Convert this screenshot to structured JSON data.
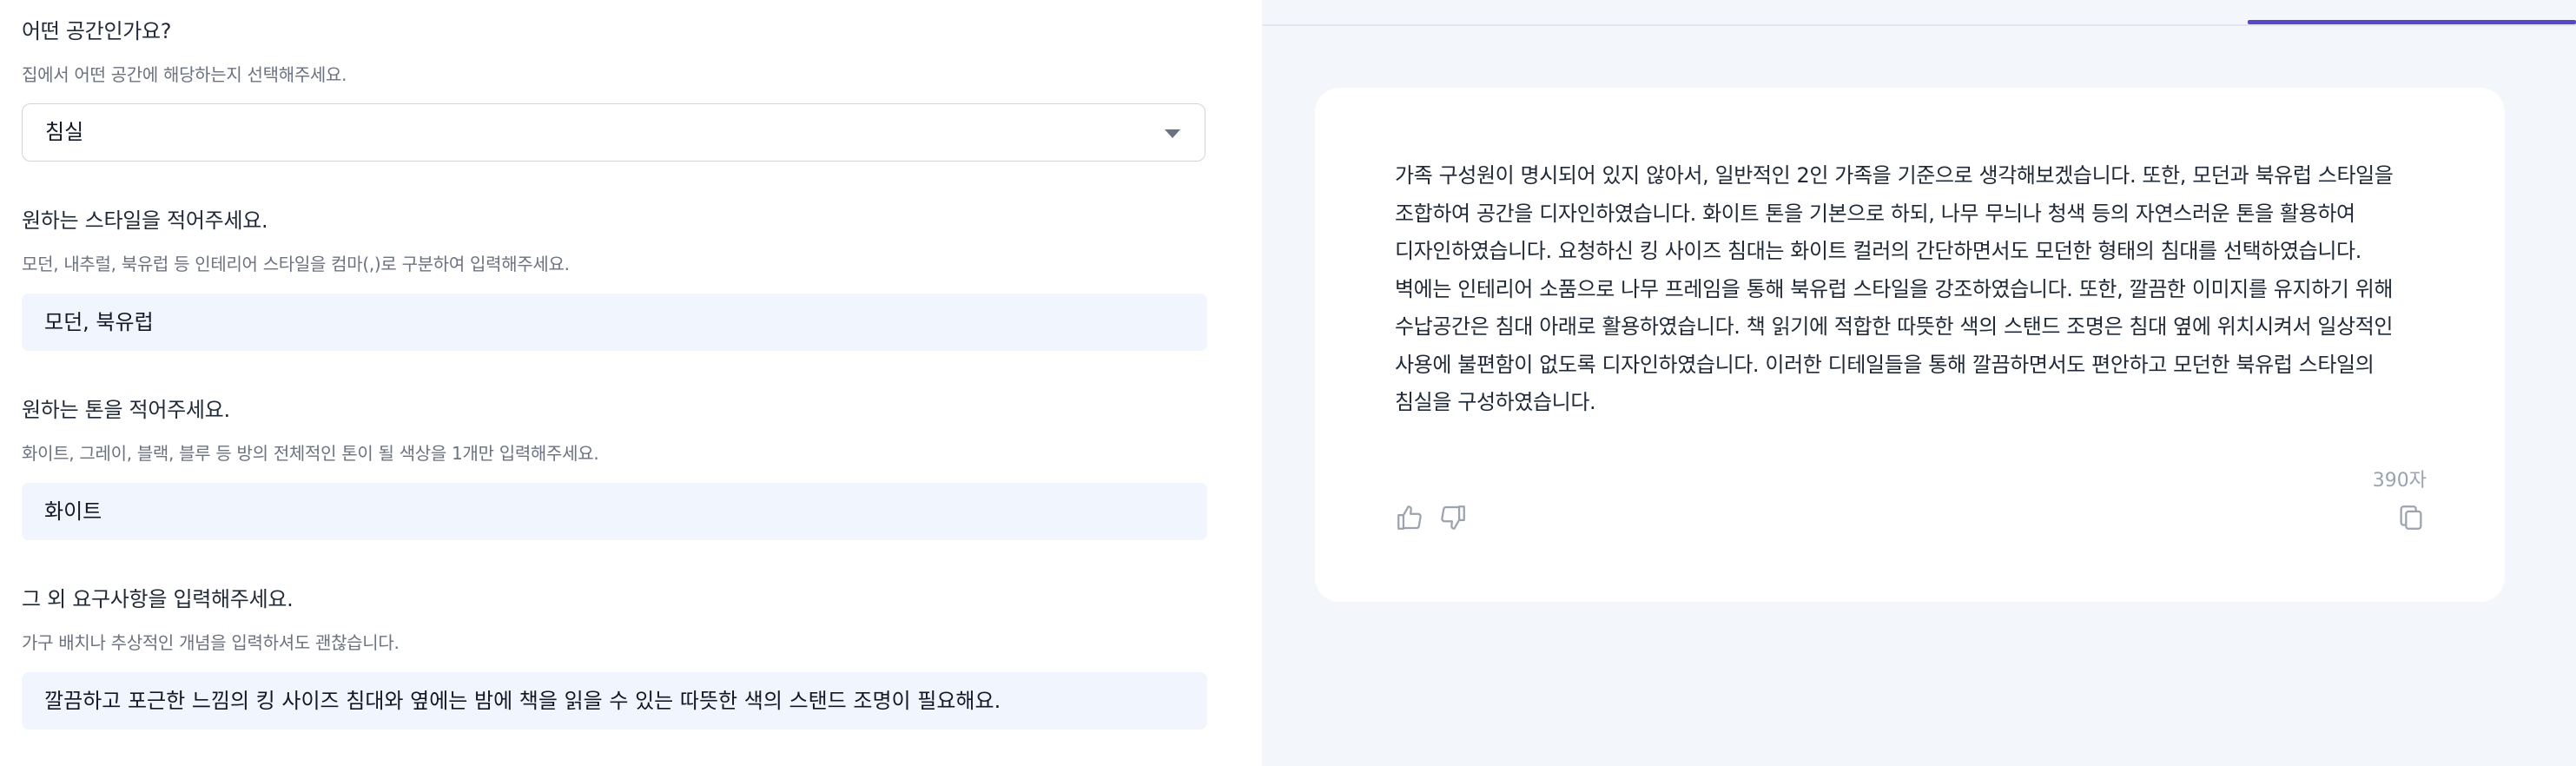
{
  "form": {
    "space": {
      "title": "어떤 공간인가요?",
      "desc": "집에서 어떤 공간에 해당하는지 선택해주세요.",
      "value": "침실"
    },
    "style": {
      "title": "원하는 스타일을 적어주세요.",
      "desc": "모던, 내추럴, 북유럽 등 인테리어 스타일을 컴마(,)로 구분하여 입력해주세요.",
      "value": "모던, 북유럽"
    },
    "tone": {
      "title": "원하는 톤을 적어주세요.",
      "desc": "화이트, 그레이, 블랙, 블루 등 방의 전체적인 톤이 될 색상을 1개만 입력해주세요.",
      "value": "화이트"
    },
    "extra": {
      "title": "그 외 요구사항을 입력해주세요.",
      "desc": "가구 배치나 추상적인 개념을 입력하셔도 괜찮습니다.",
      "value": "깔끔하고 포근한 느낌의 킹 사이즈 침대와 옆에는 밤에 책을 읽을 수 있는 따뜻한 색의 스탠드 조명이 필요해요."
    }
  },
  "result": {
    "text": "가족 구성원이 명시되어 있지 않아서, 일반적인 2인 가족을 기준으로 생각해보겠습니다. 또한, 모던과 북유럽 스타일을 조합하여 공간을 디자인하였습니다. 화이트 톤을 기본으로 하되, 나무 무늬나 청색 등의 자연스러운 톤을 활용하여 디자인하였습니다. 요청하신 킹 사이즈 침대는 화이트 컬러의 간단하면서도 모던한 형태의 침대를 선택하였습니다. 벽에는 인테리어 소품으로 나무 프레임을 통해 북유럽 스타일을 강조하였습니다. 또한, 깔끔한 이미지를 유지하기 위해 수납공간은 침대 아래로 활용하였습니다. 책 읽기에 적합한 따뜻한 색의 스탠드 조명은 침대 옆에 위치시켜서 일상적인 사용에 불편함이 없도록 디자인하였습니다. 이러한 디테일들을 통해 깔끔하면서도 편안하고 모던한 북유럽 스타일의 침실을 구성하였습니다.",
    "char_count": "390자",
    "icons": [
      "thumbs-up-icon",
      "thumbs-down-icon",
      "copy-icon"
    ]
  },
  "colors": {
    "accent": "#5b46c9",
    "input_bg": "#f1f5fd",
    "panel_bg": "#f3f6fb"
  }
}
